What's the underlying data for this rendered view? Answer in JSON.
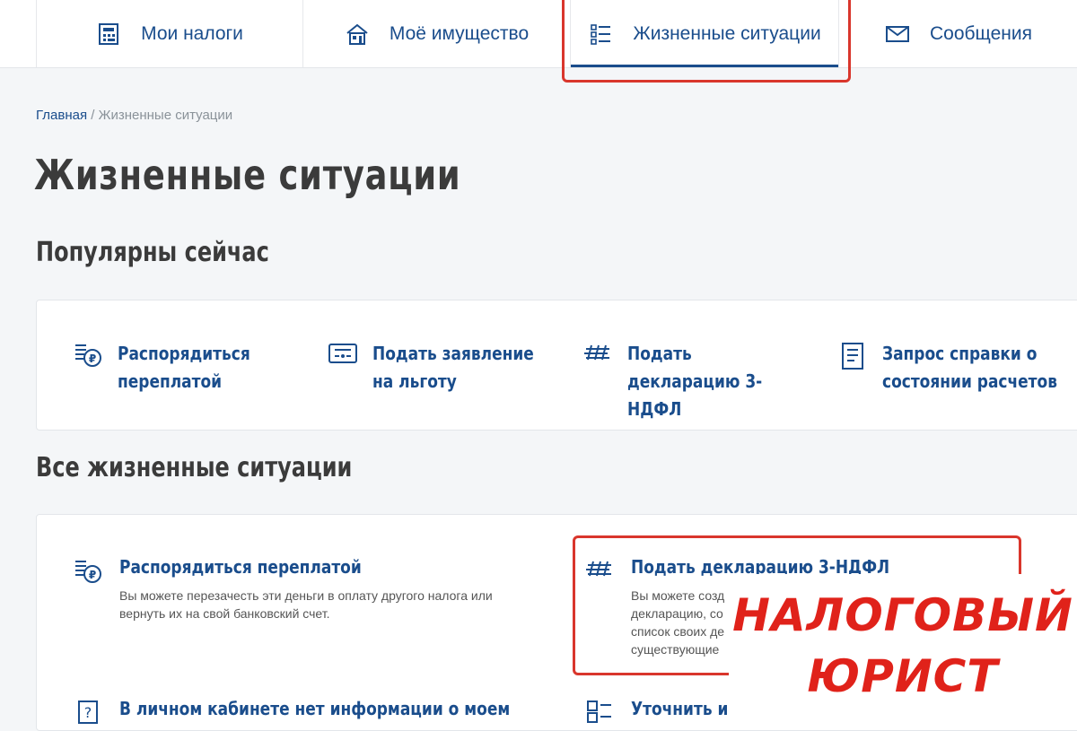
{
  "nav": {
    "tabs": [
      {
        "label": "Мои налоги",
        "icon": "calculator-icon"
      },
      {
        "label": "Моё имущество",
        "icon": "house-icon"
      },
      {
        "label": "Жизненные ситуации",
        "icon": "list-icon"
      },
      {
        "label": "Сообщения",
        "icon": "envelope-icon"
      }
    ]
  },
  "breadcrumb": {
    "home": "Главная",
    "separator": "/",
    "current": "Жизненные ситуации"
  },
  "page_title": "Жизненные ситуации",
  "popular": {
    "title": "Популярны сейчас",
    "items": [
      {
        "label": "Распорядиться переплатой",
        "icon": "overpayment-icon"
      },
      {
        "label": "Подать заявление на льготу",
        "icon": "benefit-icon"
      },
      {
        "label": "Подать декларацию 3-НДФЛ",
        "icon": "declaration-icon"
      },
      {
        "label": "Запрос справки о состоянии расчетов",
        "icon": "document-icon"
      }
    ]
  },
  "all": {
    "title": "Все жизненные ситуации",
    "items": [
      {
        "title": "Распорядиться переплатой",
        "desc": "Вы можете перезачесть эти деньги в оплату другого налога или вернуть их на свой банковский счет.",
        "icon": "overpayment-icon"
      },
      {
        "title": "Подать декларацию 3-НДФЛ",
        "desc": "Вы можете созд декларацию, со список своих де существующие",
        "icon": "declaration-icon"
      },
      {
        "title": "В личном кабинете нет информации о моем",
        "icon": "question-icon"
      },
      {
        "title": "Уточнить инс",
        "icon": "calculator-list-icon"
      }
    ]
  },
  "watermark": {
    "line1": "НАЛОГОВЫЙ",
    "line2": "ЮРИСТ"
  },
  "colors": {
    "link": "#1a4d8c",
    "highlight": "#d9362c",
    "watermark": "#e0221a",
    "background": "#f4f6f8"
  }
}
